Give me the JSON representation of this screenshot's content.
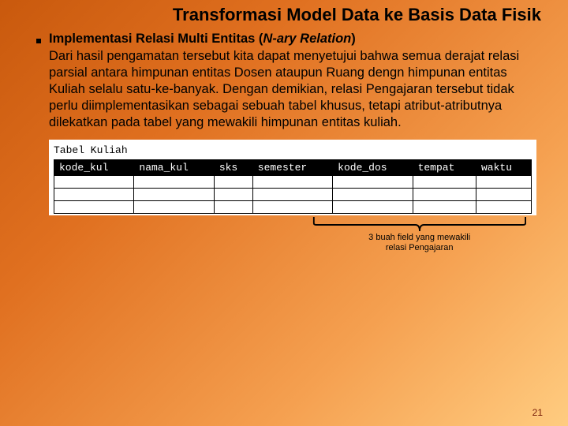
{
  "title": "Transformasi Model Data ke Basis Data Fisik",
  "subtitle_plain": "Implementasi Relasi Multi Entitas (",
  "subtitle_italic": "N-ary Relation",
  "subtitle_close": ")",
  "body": "Dari hasil pengamatan tersebut kita dapat menyetujui bahwa semua derajat relasi parsial antara himpunan entitas Dosen ataupun Ruang dengn himpunan entitas Kuliah selalu satu-ke-banyak. Dengan demikian, relasi Pengajaran tersebut tidak perlu diimplementasikan sebagai sebuah tabel khusus, tetapi atribut-atributnya dilekatkan pada tabel yang mewakili himpunan entitas kuliah.",
  "table": {
    "label": "Tabel Kuliah",
    "columns": [
      "kode_kul",
      "nama_kul",
      "sks",
      "semester",
      "kode_dos",
      "tempat",
      "waktu"
    ],
    "empty_rows": 3
  },
  "brace_caption_l1": "3 buah field yang mewakili",
  "brace_caption_l2": "relasi Pengajaran",
  "page_number": "21"
}
